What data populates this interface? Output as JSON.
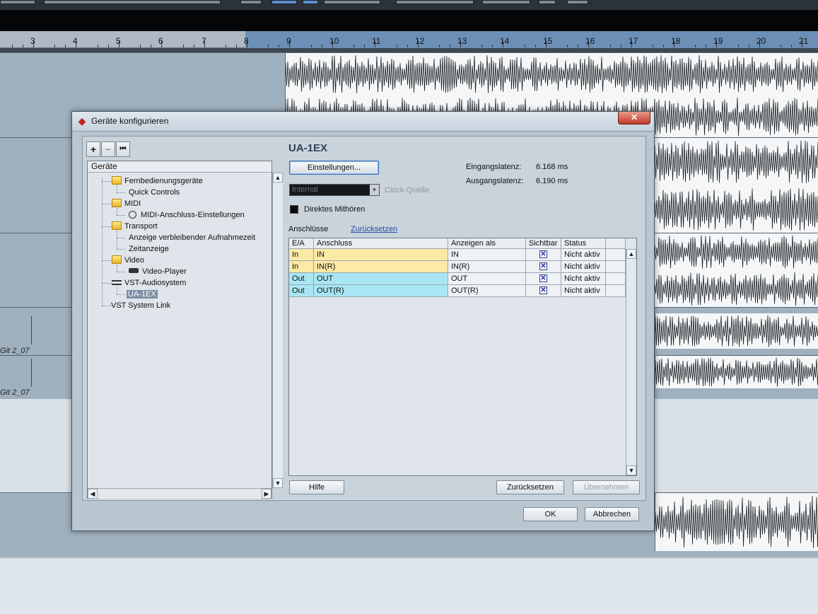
{
  "ruler": {
    "bars": [
      "3",
      "4",
      "5",
      "6",
      "7",
      "8",
      "9",
      "10",
      "11",
      "12",
      "13",
      "14",
      "15",
      "16",
      "17",
      "18",
      "19",
      "20",
      "21"
    ]
  },
  "tracks": {
    "label_1": "Git 2_07",
    "label_2": "Git 2_07"
  },
  "dialog": {
    "title": "Geräte konfigurieren",
    "close_glyph": "✕",
    "tree_toolbar": {
      "add": "+",
      "remove": "−",
      "reset": "⏮"
    },
    "tree": {
      "header": "Geräte",
      "items": [
        "Fernbedienungsgeräte",
        "Quick Controls",
        "MIDI",
        "MIDI-Anschluss-Einstellungen",
        "Transport",
        "Anzeige verbleibender Aufnahmezeit",
        "Zeitanzeige",
        "Video",
        "Video-Player",
        "VST-Audiosystem",
        "UA-1EX",
        "VST System Link"
      ]
    },
    "device": {
      "name": "UA-1EX",
      "settings_button": "Einstellungen...",
      "clock_value": "Internal",
      "clock_label": "Clock-Quelle",
      "direct_monitoring": "Direktes Mithören",
      "input_latency_label": "Eingangslatenz:",
      "input_latency_value": "6.168 ms",
      "output_latency_label": "Ausgangslatenz:",
      "output_latency_value": "6.190 ms",
      "ports_label": "Anschlüsse",
      "reset_link": "Zurücksetzen"
    },
    "table": {
      "columns": [
        "E/A",
        "Anschluss",
        "Anzeigen als",
        "Sichtbar",
        "Status"
      ],
      "rows": [
        {
          "io": "In",
          "port": "IN",
          "show_as": "IN",
          "visible": "✕",
          "status": "Nicht aktiv"
        },
        {
          "io": "In",
          "port": "IN(R)",
          "show_as": "IN(R)",
          "visible": "✕",
          "status": "Nicht aktiv"
        },
        {
          "io": "Out",
          "port": "OUT",
          "show_as": "OUT",
          "visible": "✕",
          "status": "Nicht aktiv"
        },
        {
          "io": "Out",
          "port": "OUT(R)",
          "show_as": "OUT(R)",
          "visible": "✕",
          "status": "Nicht aktiv"
        }
      ]
    },
    "buttons": {
      "help": "Hilfe",
      "reset": "Zurücksetzen",
      "apply": "Übernehmen",
      "ok": "OK",
      "cancel": "Abbrechen"
    },
    "colors": {
      "input_row": "#fbe9a6",
      "output_row": "#a9e6f3",
      "selection": "#7b8fa3"
    }
  }
}
